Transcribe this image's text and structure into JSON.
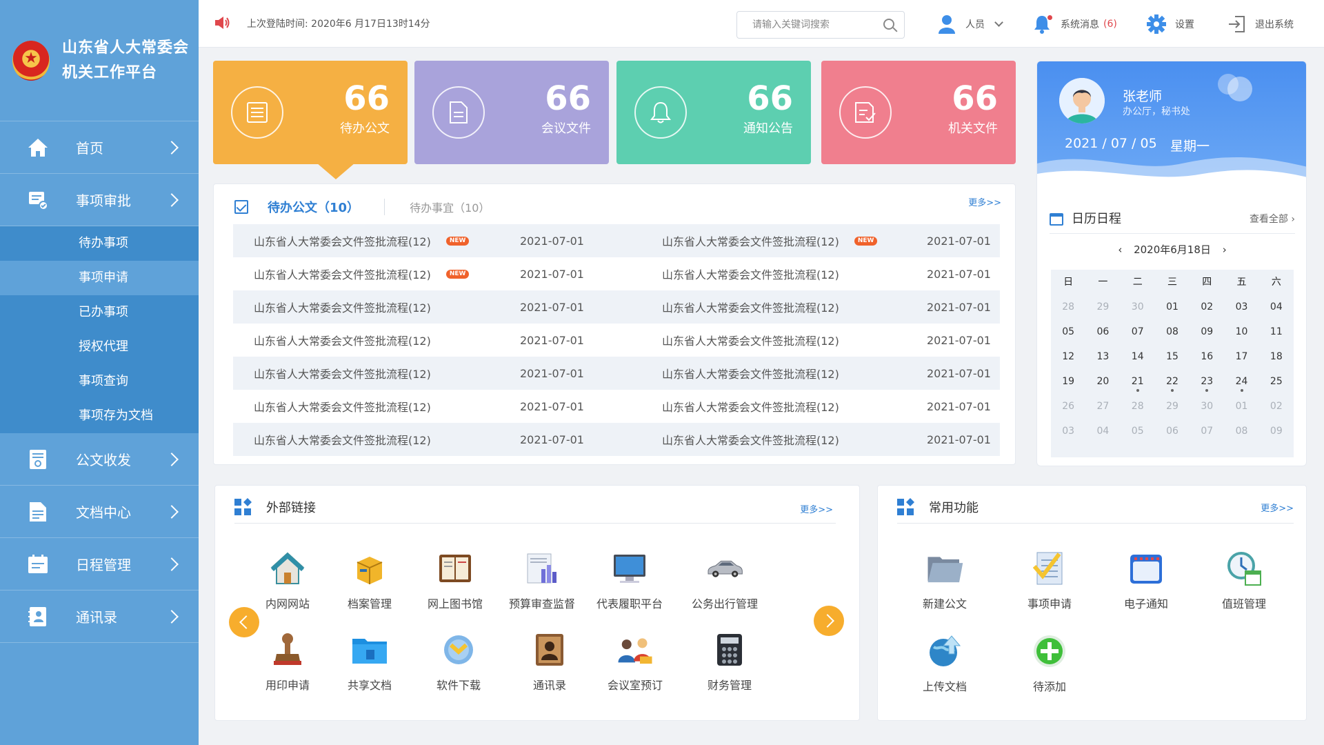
{
  "brand": {
    "line1": "山东省人大常委会",
    "line2": "机关工作平台"
  },
  "topbar": {
    "last_login": "上次登陆时间: 2020年6 月17日13时14分",
    "search_placeholder": "请输入关键词搜索",
    "user_label": "人员",
    "messages_label": "系统消息",
    "messages_count": "(6)",
    "settings_label": "设置",
    "logout_label": "退出系统"
  },
  "nav": {
    "home": "首页",
    "approval": "事项审批",
    "approval_sub": [
      "待办事项",
      "事项申请",
      "已办事项",
      "授权代理",
      "事项查询",
      "事项存为文档"
    ],
    "documents_flow": "公文收发",
    "doc_center": "文档中心",
    "schedule": "日程管理",
    "contacts": "通讯录"
  },
  "stats": [
    {
      "value": "66",
      "label": "待办公文",
      "color": "#f5b043",
      "icon": "document-list-icon"
    },
    {
      "value": "66",
      "label": "会议文件",
      "color": "#a9a3db",
      "icon": "file-icon"
    },
    {
      "value": "66",
      "label": "通知公告",
      "color": "#5dcfb0",
      "icon": "bell-icon"
    },
    {
      "value": "66",
      "label": "机关文件",
      "color": "#f07f8e",
      "icon": "edit-document-icon"
    }
  ],
  "pending": {
    "tab_active": "待办公文（10）",
    "tab_inactive": "待办事宜（10）",
    "more": "更多>>",
    "badge": "NEW",
    "rows": [
      {
        "title1": "山东省人大常委会文件签批流程(12)",
        "new1": true,
        "date1": "2021-07-01",
        "title2": "山东省人大常委会文件签批流程(12)",
        "new2": true,
        "date2": "2021-07-01"
      },
      {
        "title1": "山东省人大常委会文件签批流程(12)",
        "new1": true,
        "date1": "2021-07-01",
        "title2": "山东省人大常委会文件签批流程(12)",
        "new2": false,
        "date2": "2021-07-01"
      },
      {
        "title1": "山东省人大常委会文件签批流程(12)",
        "new1": false,
        "date1": "2021-07-01",
        "title2": "山东省人大常委会文件签批流程(12)",
        "new2": false,
        "date2": "2021-07-01"
      },
      {
        "title1": "山东省人大常委会文件签批流程(12)",
        "new1": false,
        "date1": "2021-07-01",
        "title2": "山东省人大常委会文件签批流程(12)",
        "new2": false,
        "date2": "2021-07-01"
      },
      {
        "title1": "山东省人大常委会文件签批流程(12)",
        "new1": false,
        "date1": "2021-07-01",
        "title2": "山东省人大常委会文件签批流程(12)",
        "new2": false,
        "date2": "2021-07-01"
      },
      {
        "title1": "山东省人大常委会文件签批流程(12)",
        "new1": false,
        "date1": "2021-07-01",
        "title2": "山东省人大常委会文件签批流程(12)",
        "new2": false,
        "date2": "2021-07-01"
      },
      {
        "title1": "山东省人大常委会文件签批流程(12)",
        "new1": false,
        "date1": "2021-07-01",
        "title2": "山东省人大常委会文件签批流程(12)",
        "new2": false,
        "date2": "2021-07-01"
      }
    ]
  },
  "profile": {
    "name": "张老师",
    "dept": "办公厅，秘书处",
    "date": "2021 / 07 / 05",
    "weekday": "星期一"
  },
  "calendar": {
    "title": "日历日程",
    "view_all": "查看全部",
    "month": "2020年6月18日",
    "weekdays": [
      "日",
      "一",
      "二",
      "三",
      "四",
      "五",
      "六"
    ],
    "weeks": [
      [
        {
          "d": "28",
          "m": true
        },
        {
          "d": "29",
          "m": true
        },
        {
          "d": "30",
          "m": true
        },
        {
          "d": "01"
        },
        {
          "d": "02"
        },
        {
          "d": "03"
        },
        {
          "d": "04"
        }
      ],
      [
        {
          "d": "05"
        },
        {
          "d": "06"
        },
        {
          "d": "07"
        },
        {
          "d": "08"
        },
        {
          "d": "09"
        },
        {
          "d": "10"
        },
        {
          "d": "11"
        }
      ],
      [
        {
          "d": "12"
        },
        {
          "d": "13"
        },
        {
          "d": "14"
        },
        {
          "d": "15"
        },
        {
          "d": "16"
        },
        {
          "d": "17"
        },
        {
          "d": "18"
        }
      ],
      [
        {
          "d": "19"
        },
        {
          "d": "20"
        },
        {
          "d": "21",
          "dot": true
        },
        {
          "d": "22",
          "dot": true
        },
        {
          "d": "23",
          "dot": true
        },
        {
          "d": "24",
          "dot": true
        },
        {
          "d": "25"
        }
      ],
      [
        {
          "d": "26",
          "m": true
        },
        {
          "d": "27",
          "m": true
        },
        {
          "d": "28",
          "m": true
        },
        {
          "d": "29",
          "m": true
        },
        {
          "d": "30",
          "m": true
        },
        {
          "d": "01",
          "m": true
        },
        {
          "d": "02",
          "m": true
        }
      ],
      [
        {
          "d": "03",
          "m": true
        },
        {
          "d": "04",
          "m": true
        },
        {
          "d": "05",
          "m": true
        },
        {
          "d": "06",
          "m": true
        },
        {
          "d": "07",
          "m": true
        },
        {
          "d": "08",
          "m": true
        },
        {
          "d": "09",
          "m": true
        }
      ]
    ]
  },
  "external_links": {
    "title": "外部链接",
    "more": "更多>>",
    "row1": [
      {
        "label": "内网网站",
        "icon": "home-icon"
      },
      {
        "label": "档案管理",
        "icon": "archive-icon"
      },
      {
        "label": "网上图书馆",
        "icon": "library-icon"
      },
      {
        "label": "预算审查监督",
        "icon": "budget-chart-icon"
      },
      {
        "label": "代表履职平台",
        "icon": "monitor-icon"
      },
      {
        "label": "公务出行管理",
        "icon": "car-icon"
      }
    ],
    "row2": [
      {
        "label": "用印申请",
        "icon": "stamp-icon"
      },
      {
        "label": "共享文档",
        "icon": "shared-folder-icon"
      },
      {
        "label": "软件下载",
        "icon": "download-icon"
      },
      {
        "label": "通讯录",
        "icon": "address-book-icon"
      },
      {
        "label": "会议室预订",
        "icon": "meeting-icon"
      },
      {
        "label": "财务管理",
        "icon": "calculator-icon"
      }
    ]
  },
  "common_functions": {
    "title": "常用功能",
    "more": "更多>>",
    "items": [
      {
        "label": "新建公文",
        "icon": "folder-icon"
      },
      {
        "label": "事项申请",
        "icon": "checklist-icon"
      },
      {
        "label": "电子通知",
        "icon": "notice-calendar-icon"
      },
      {
        "label": "值班管理",
        "icon": "clock-calendar-icon"
      },
      {
        "label": "上传文档",
        "icon": "upload-globe-icon"
      },
      {
        "label": "待添加",
        "icon": "add-icon"
      }
    ]
  }
}
